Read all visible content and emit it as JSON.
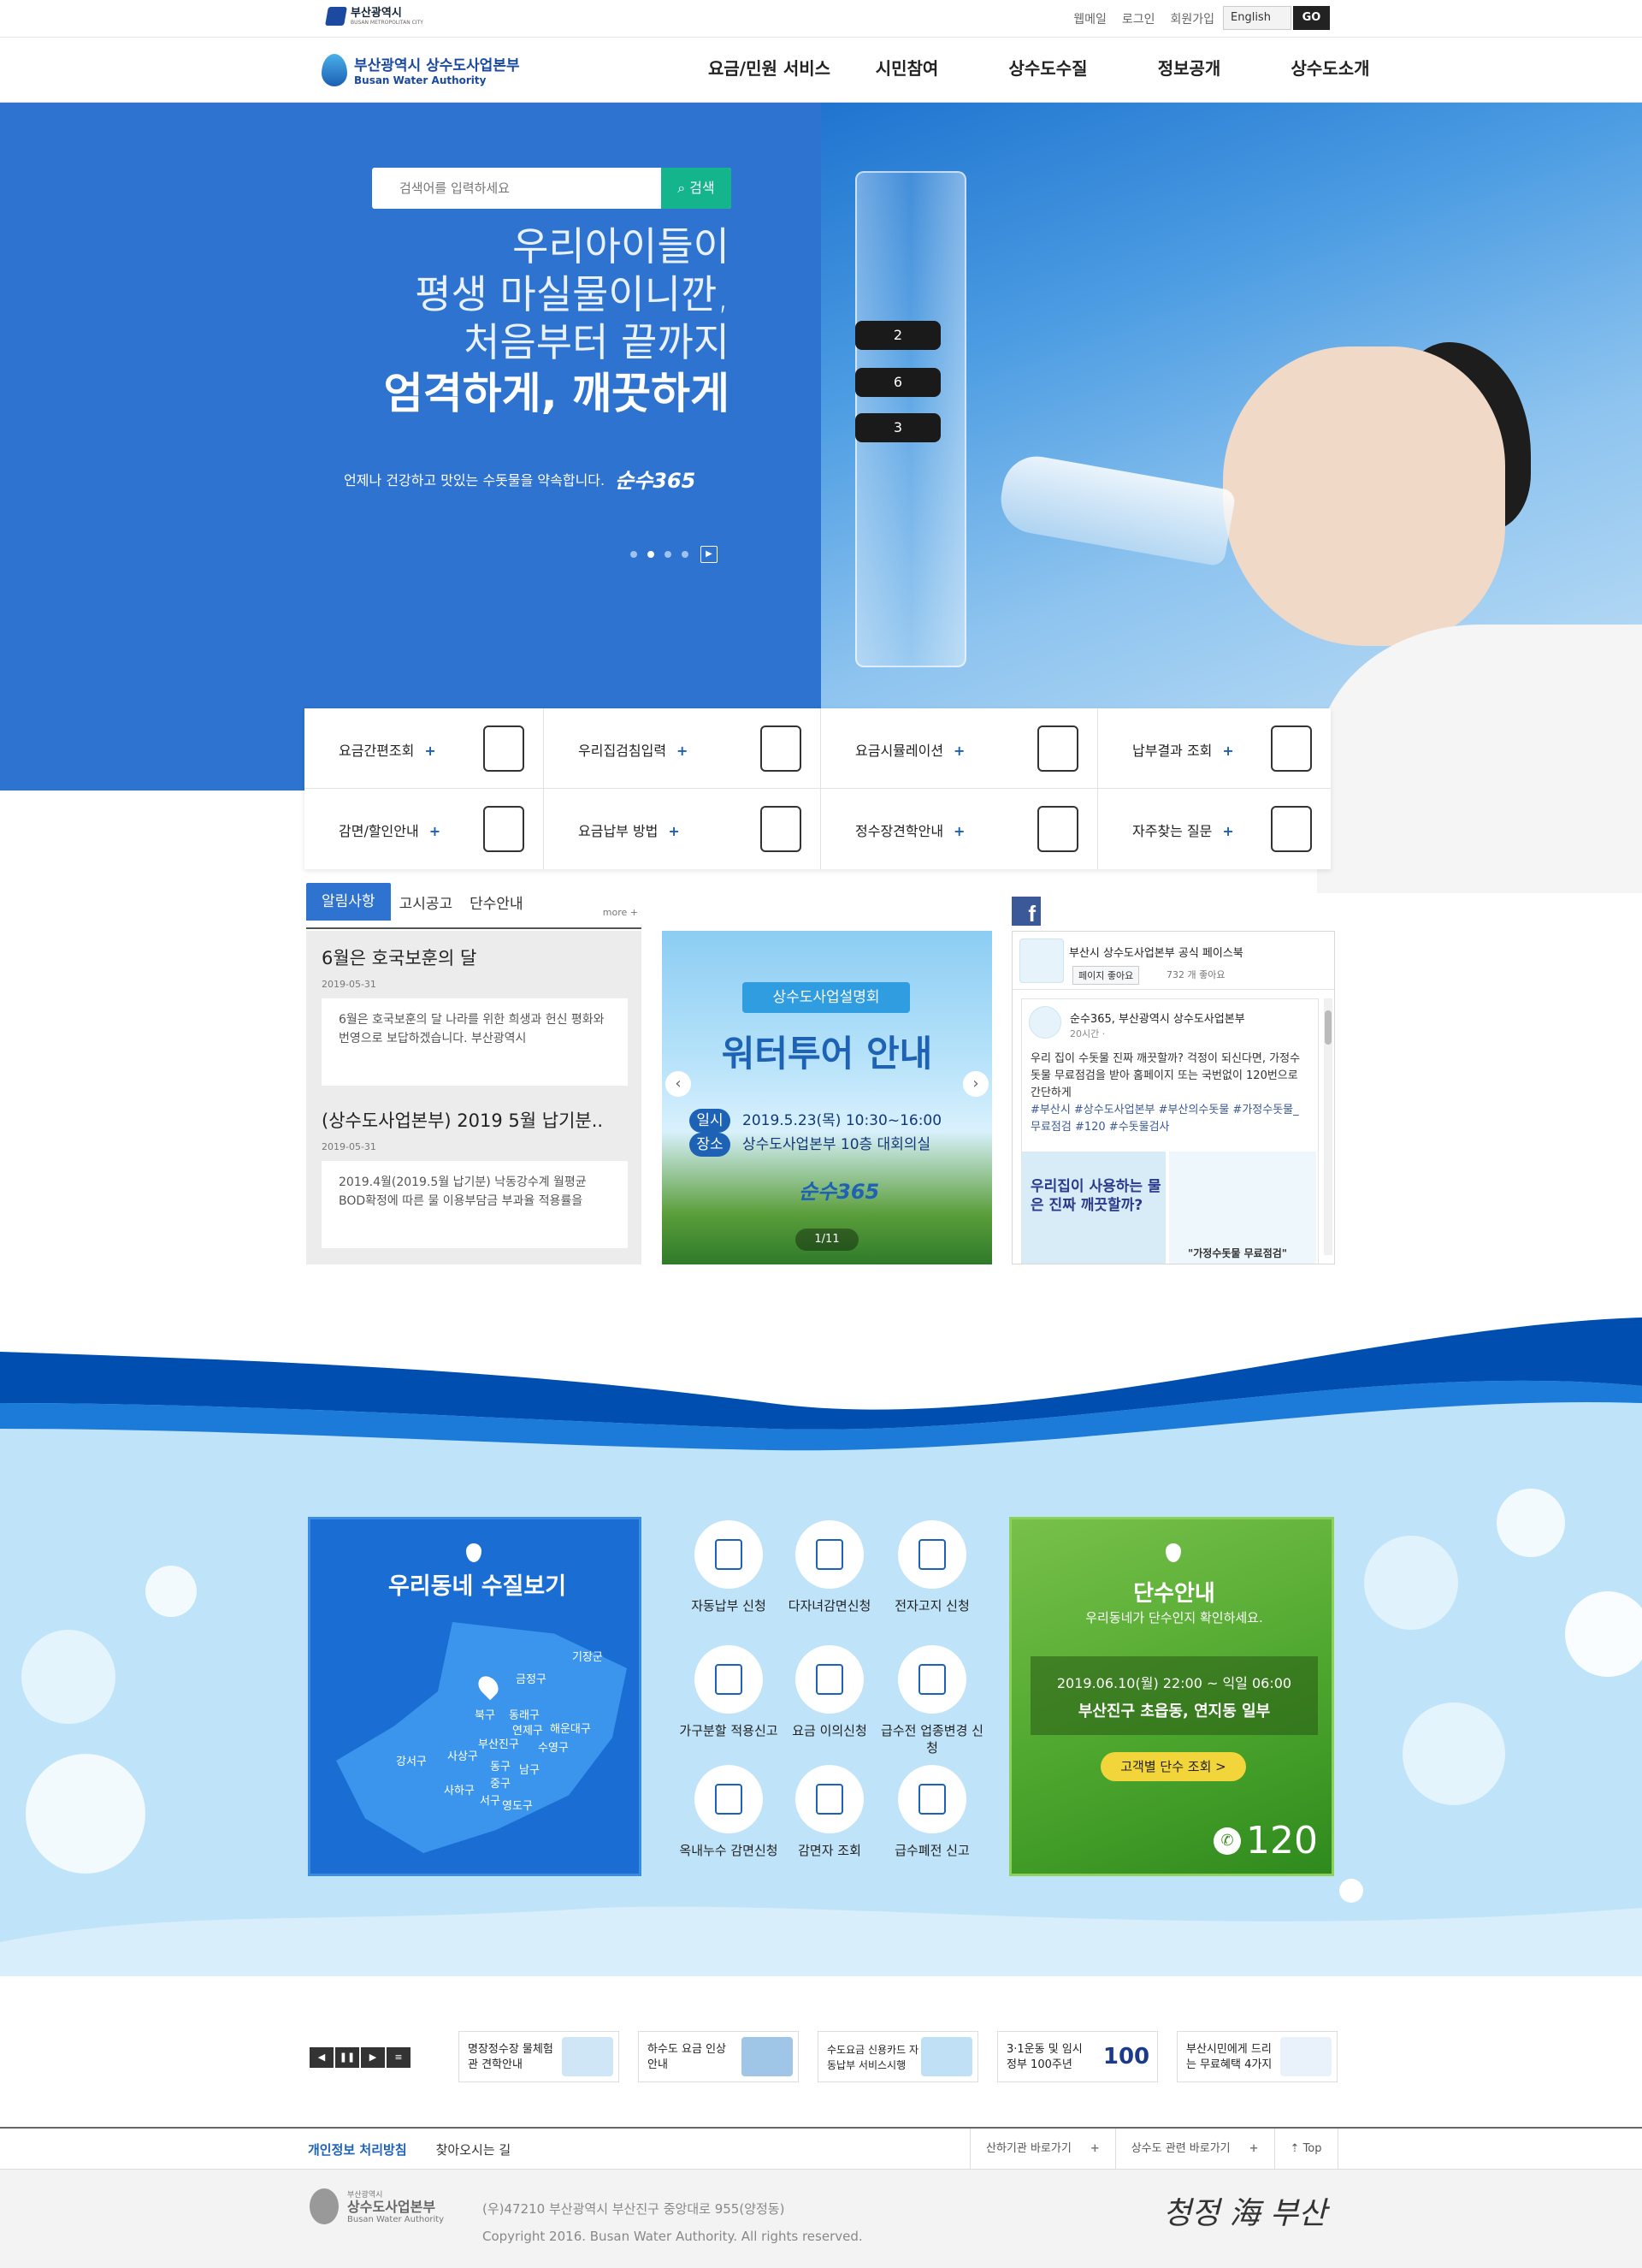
{
  "utility": {
    "gov_name": "부산광역시",
    "gov_sub": "BUSAN METROPOLITAN CITY",
    "links": [
      "웹메일",
      "로그인",
      "회원가입"
    ],
    "language": "English",
    "go_label": "GO"
  },
  "header": {
    "logo_kor": "부산광역시 상수도사업본부",
    "logo_eng": "Busan Water Authority",
    "nav": [
      "요금/민원 서비스",
      "시민참여",
      "상수도수질",
      "정보공개",
      "상수도소개"
    ]
  },
  "hero": {
    "search_placeholder": "검색어를 입력하세요",
    "search_button": "검색",
    "copy_lines": [
      "우리아이들이",
      "평생 마실물이니깐,",
      "처음부터 끝까지"
    ],
    "copy_bold": "엄격하게, 깨끗하게",
    "tagline": "언제나 건강하고 맛있는 수돗물을 약속합니다.",
    "brand": "순수365",
    "glass_numbers": [
      "2",
      "6",
      "3"
    ],
    "slide_total": 4,
    "slide_current": 2
  },
  "quick_menu": [
    {
      "label": "요금간편조회"
    },
    {
      "label": "우리집검침입력"
    },
    {
      "label": "요금시뮬레이션"
    },
    {
      "label": "납부결과 조회"
    },
    {
      "label": "감면/할인안내"
    },
    {
      "label": "요금납부 방법"
    },
    {
      "label": "정수장견학안내"
    },
    {
      "label": "자주찾는 질문"
    }
  ],
  "notice": {
    "tabs": [
      "알림사항",
      "고시공고",
      "단수안내"
    ],
    "more": "more +",
    "items": [
      {
        "title": "6월은 호국보훈의 달",
        "date": "2019-05-31",
        "body": "6월은 호국보훈의 달 나라를 위한 희생과 헌신 평화와 번영으로 보답하겠습니다. 부산광역시"
      },
      {
        "title": "(상수도사업본부) 2019 5월 납기분..",
        "date": "2019-05-31",
        "body": "2019.4월(2019.5월 납기분) 낙동강수계 월평균 BOD확정에 따른 물 이용부담금 부과율 적용률을"
      }
    ]
  },
  "banner": {
    "badge": "상수도사업설명회",
    "title": "워터투어 안내",
    "when_label": "일시",
    "when": "2019.5.23(목) 10:30~16:00",
    "where_label": "장소",
    "where": "상수도사업본부 10층 대회의실",
    "brand": "순수365",
    "page": "1/11"
  },
  "facebook": {
    "page_name": "부산시 상수도사업본부 공식 페이스북",
    "like_label": "페이지 좋아요",
    "like_count": "732 개 좋아요",
    "post_author": "순수365, 부산광역시 상수도사업본부",
    "post_time": "20시간 · ",
    "post_text": "우리 집이 수돗물 진짜 깨끗할까? 걱정이 되신다면, 가정수돗물 무료점검을 받아 홈페이지 또는 국번없이 120번으로 간단하게",
    "post_tags": "#부산시 #상수도사업본부 #부산의수돗물 #가정수돗물_무료점검 #120 #수돗물검사",
    "img1_text": "우리집이 사용하는 물은 진짜 깨끗할까?",
    "img2_text": "\"가정수돗물 무료점검\""
  },
  "water_map": {
    "title": "우리동네 수질보기",
    "districts": [
      "기장군",
      "금정구",
      "북구",
      "동래구",
      "해운대구",
      "연제구",
      "수영구",
      "강서구",
      "사상구",
      "부산진구",
      "남구",
      "동구",
      "중구",
      "사하구",
      "서구",
      "영도구"
    ]
  },
  "services": [
    {
      "label": "자동납부 신청"
    },
    {
      "label": "다자녀감면신청"
    },
    {
      "label": "전자고지 신청"
    },
    {
      "label": "가구분할 적용신고"
    },
    {
      "label": "요금 이의신청"
    },
    {
      "label": "급수전 업종변경 신청"
    },
    {
      "label": "옥내누수 감면신청"
    },
    {
      "label": "감면자 조회"
    },
    {
      "label": "급수폐전 신고"
    }
  ],
  "outage": {
    "title": "단수안내",
    "subtitle": "우리동네가 단수인지 확인하세요.",
    "datetime": "2019.06.10(월) 22:00 ~ 익일 06:00",
    "area": "부산진구 초읍동, 연지동 일부",
    "button": "고객별 단수 조회 >",
    "phone": "120"
  },
  "related": {
    "controls": [
      "◀",
      "❚❚",
      "▶",
      "≡"
    ],
    "items": [
      {
        "text": "명장정수장 물체험관 견학안내",
        "color": "#cfe6f7"
      },
      {
        "text": "하수도 요금 인상 안내",
        "color": "#9fc6e6"
      },
      {
        "text": "수도요금 신용카드 자동납부 서비스시행",
        "color": "#bfe0f5"
      },
      {
        "text": "3·1운동 및 임시정부 100주년",
        "color": "#ffffff"
      },
      {
        "text": "부산시민에게 드리는 무료혜택 4가지",
        "color": "#e9f2fb"
      }
    ]
  },
  "footer": {
    "links": [
      "개인정보 처리방침",
      "찾아오시는 길"
    ],
    "right": [
      "산하기관 바로가기",
      "상수도 관련 바로가기",
      "Top"
    ],
    "logo_top": "부산광역시",
    "logo_main": "상수도사업본부",
    "logo_eng": "Busan Water Authority",
    "address": "(우)47210 부산광역시 부산진구 중앙대로 955(양정동)",
    "copyright": "Copyright 2016. Busan Water Authority. All rights reserved.",
    "slogan": "청정 海 부산"
  }
}
